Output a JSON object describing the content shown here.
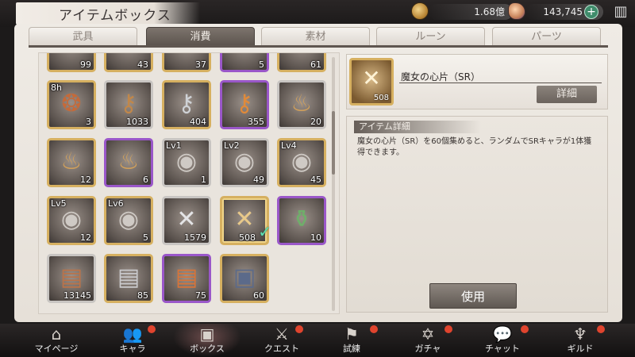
{
  "header": {
    "title": "アイテムボックス",
    "gold": "1.68億",
    "gems": "143,745",
    "plus": "+",
    "menu": "▥"
  },
  "tabs": [
    {
      "label": "武具",
      "active": false
    },
    {
      "label": "消費",
      "active": true
    },
    {
      "label": "素材",
      "active": false
    },
    {
      "label": "ルーン",
      "active": false
    },
    {
      "label": "パーツ",
      "active": false
    }
  ],
  "items": [
    {
      "count": "99",
      "lv": "",
      "frame": "gold",
      "icon": "partial-item"
    },
    {
      "count": "43",
      "lv": "",
      "frame": "gold",
      "icon": "partial-item"
    },
    {
      "count": "37",
      "lv": "",
      "frame": "gold",
      "icon": "partial-item"
    },
    {
      "count": "5",
      "lv": "",
      "frame": "purple",
      "icon": "partial-item"
    },
    {
      "count": "61",
      "lv": "",
      "frame": "gold",
      "icon": "partial-item"
    },
    {
      "count": "3",
      "lv": "8h",
      "frame": "gold",
      "icon": "orb-bundle-icon"
    },
    {
      "count": "1033",
      "lv": "",
      "frame": "silver",
      "icon": "key-icon"
    },
    {
      "count": "404",
      "lv": "",
      "frame": "gold",
      "icon": "key-icon"
    },
    {
      "count": "355",
      "lv": "",
      "frame": "purple",
      "icon": "key-icon"
    },
    {
      "count": "20",
      "lv": "",
      "frame": "silver",
      "icon": "gem-bag-icon"
    },
    {
      "count": "12",
      "lv": "",
      "frame": "gold",
      "icon": "gem-bag-icon"
    },
    {
      "count": "6",
      "lv": "",
      "frame": "purple",
      "icon": "gem-bag-icon"
    },
    {
      "count": "1",
      "lv": "Lv1",
      "frame": "silver",
      "icon": "seal-icon"
    },
    {
      "count": "49",
      "lv": "Lv2",
      "frame": "silver",
      "icon": "seal-icon"
    },
    {
      "count": "45",
      "lv": "Lv4",
      "frame": "gold",
      "icon": "seal-icon"
    },
    {
      "count": "12",
      "lv": "Lv5",
      "frame": "gold",
      "icon": "seal-icon"
    },
    {
      "count": "5",
      "lv": "Lv6",
      "frame": "gold",
      "icon": "seal-icon"
    },
    {
      "count": "1579",
      "lv": "",
      "frame": "silver",
      "icon": "shard-icon"
    },
    {
      "count": "508",
      "lv": "",
      "frame": "gold",
      "icon": "shard-icon",
      "selected": true
    },
    {
      "count": "10",
      "lv": "",
      "frame": "purple",
      "icon": "potion-pot-icon"
    },
    {
      "count": "13145",
      "lv": "",
      "frame": "silver",
      "icon": "chest-icon"
    },
    {
      "count": "85",
      "lv": "",
      "frame": "silver",
      "icon": "chest-icon"
    },
    {
      "count": "75",
      "lv": "",
      "frame": "purple",
      "icon": "chest-icon"
    },
    {
      "count": "60",
      "lv": "",
      "frame": "gold",
      "icon": "chest-icon"
    }
  ],
  "detail": {
    "name": "魔女の心片（SR）",
    "count": "508",
    "detail_button": "詳細",
    "section_header": "アイテム詳細",
    "description": "魔女の心片（SR）を60個集めると、ランダムでSRキャラが1体獲得できます。",
    "use_button": "使用"
  },
  "nav": [
    {
      "label": "マイページ",
      "icon": "home-icon",
      "glyph": "⌂",
      "badge": false,
      "active": false
    },
    {
      "label": "キャラ",
      "icon": "characters-icon",
      "glyph": "👥",
      "badge": true,
      "active": false
    },
    {
      "label": "ボックス",
      "icon": "box-icon",
      "glyph": "▣",
      "badge": false,
      "active": true
    },
    {
      "label": "クエスト",
      "icon": "swords-icon",
      "glyph": "⚔",
      "badge": true,
      "active": false
    },
    {
      "label": "試練",
      "icon": "flag-icon",
      "glyph": "⚑",
      "badge": true,
      "active": false
    },
    {
      "label": "ガチャ",
      "icon": "hexagram-icon",
      "glyph": "✡",
      "badge": true,
      "active": false
    },
    {
      "label": "チャット",
      "icon": "chat-icon",
      "glyph": "💬",
      "badge": true,
      "active": false
    },
    {
      "label": "ギルド",
      "icon": "guild-crest-icon",
      "glyph": "♆",
      "badge": true,
      "active": false
    }
  ],
  "colors": {
    "gold_frame": "#d6b060",
    "silver_frame": "#c8c5c2",
    "purple_frame": "#9a57c9",
    "badge": "#e0442e",
    "check": "#5ee0b0"
  }
}
